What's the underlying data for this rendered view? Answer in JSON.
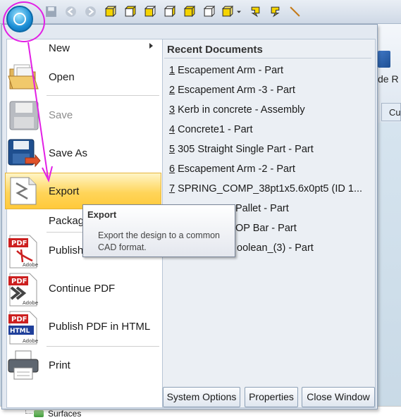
{
  "menu": {
    "items": [
      {
        "label": "New",
        "icon": "new-icon",
        "enabled": true,
        "submenu": true
      },
      {
        "label": "Open",
        "icon": "folder-open-icon",
        "enabled": true
      },
      {
        "label": "Save",
        "icon": "floppy-disk-icon",
        "enabled": false
      },
      {
        "label": "Save As",
        "icon": "save-as-icon",
        "enabled": true
      },
      {
        "label": "Export",
        "icon": "export-icon",
        "enabled": true,
        "highlighted": true
      },
      {
        "label": "Package",
        "icon": "package-icon",
        "enabled": true
      },
      {
        "label": "Publish",
        "icon": "pdf-icon",
        "enabled": true
      },
      {
        "label": "Continue PDF",
        "icon": "continue-pdf-icon",
        "enabled": true
      },
      {
        "label": "Publish PDF in HTML",
        "icon": "pdf-html-icon",
        "enabled": true
      },
      {
        "label": "Print",
        "icon": "printer-icon",
        "enabled": true
      }
    ]
  },
  "recent": {
    "title": "Recent Documents",
    "items": [
      {
        "num": "1",
        "text": " Escapement Arm - Part"
      },
      {
        "num": "2",
        "text": " Escapement Arm -3 - Part"
      },
      {
        "num": "3",
        "text": " Kerb in concrete - Assembly"
      },
      {
        "num": "4",
        "text": " Concrete1 - Part"
      },
      {
        "num": "5",
        "text": " 305 Straight Single Part - Part"
      },
      {
        "num": "6",
        "text": " Escapement Arm -2 - Part"
      },
      {
        "num": "7",
        "text": " SPRING_COMP_38pt1x5.6x0pt5 (ID 1..."
      },
      {
        "num": "",
        "text": "Pallet - Part"
      },
      {
        "num": "",
        "text": "OP Bar - Part"
      },
      {
        "num": "",
        "text": "oolean_(3) - Part"
      }
    ]
  },
  "buttons": {
    "system_options": "System Options",
    "properties": "Properties",
    "close_window": "Close Window"
  },
  "tooltip": {
    "title": "Export",
    "body": "Export the design to a common CAD format."
  },
  "background": {
    "ribbon_text": "de R",
    "tab_text": "Cu",
    "tree_label": "Surfaces"
  },
  "colors": {
    "highlight": "#ffd55a",
    "annotation": "#e21fe5",
    "orb": "#1c8fd6"
  }
}
